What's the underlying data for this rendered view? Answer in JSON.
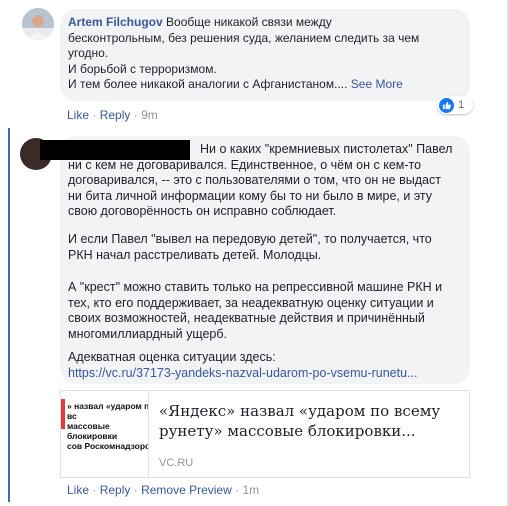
{
  "comment1": {
    "author": "Artem Filchugov",
    "text_line1": "Вообще никакой связи между",
    "text_line2": "бесконтрольным, без решения суда, желанием следить за чем",
    "text_line3": "угодно.",
    "text_line4": "И борьбой с терроризмом.",
    "text_line5": "И тем более никакой аналогии с Афганистаном....",
    "see_more": "See More",
    "reaction_count": "1",
    "reaction_icon": "like-icon",
    "actions": {
      "like": "Like",
      "reply": "Reply",
      "time": "9m"
    }
  },
  "comment2": {
    "line1": "Ни о каких \"кремниевых пистолетах\" Павел",
    "line2": "ни с кем не договаривался. Единственное, о чём он с кем-то",
    "line3": "договаривался, -- это с пользователями о том, что он не выдаст",
    "line4": "ни бита личной информации кому бы то ни было в мире, и эту",
    "line5": "свою договорённость он исправно соблюдает.",
    "p2_line1": "И если Павел \"вывел на передовую детей\", то получается, что",
    "p2_line2": "РКН начал расстреливать детей. Молодцы.",
    "p3_line1": "А \"крест\" можно ставить только на репрессивной машине РКН и",
    "p3_line2": "тех, кто его поддерживает, за неадекватную оценку ситуации и",
    "p3_line3": "своих возможностей, неадекватные действия и причинённый",
    "p3_line4": "многомиллиардный ущерб.",
    "p4_line1": "Адекватная оценка ситуации здесь:",
    "url": "https://vc.ru/37173-yandeks-nazval-udarom-po-vsemu-runetu...",
    "actions": {
      "like": "Like",
      "reply": "Reply",
      "remove_preview": "Remove Preview",
      "time": "1m"
    }
  },
  "link_preview": {
    "thumb_line1": "» назвал «ударом по вс",
    "thumb_line2": "массовые блокировки",
    "thumb_line3": "сов Роскомнадзором",
    "title_line1": "«Яндекс» назвал «ударом по всему",
    "title_line2": "рунету» массовые блокировки...",
    "domain": "VC.RU"
  },
  "colors": {
    "link": "#385898",
    "thread": "#4267b2",
    "bubble": "#f2f3f5",
    "like_blue": "#1877f2"
  }
}
